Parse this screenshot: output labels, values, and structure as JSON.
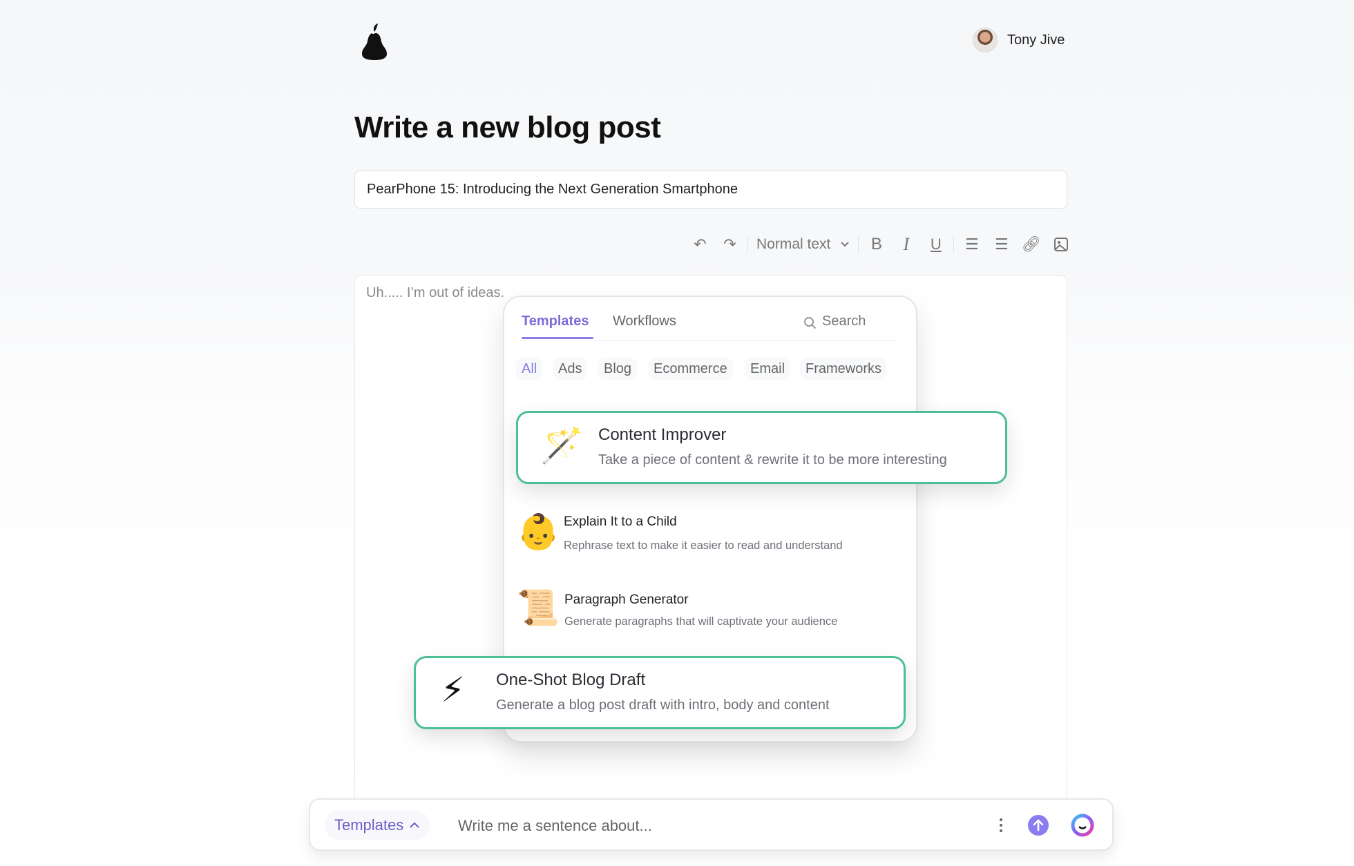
{
  "header": {
    "logo": "pear-logo",
    "user_name": "Tony Jive"
  },
  "page_title": "Write a new blog post",
  "title_input": {
    "value": "PearPhone 15: Introducing the Next Generation Smartphone"
  },
  "toolbar": {
    "text_style": "Normal text",
    "icons": [
      "undo-icon",
      "redo-icon",
      "chevron-down-icon",
      "bold-icon",
      "italic-icon",
      "underline-icon",
      "bullet-list-icon",
      "numbered-list-icon",
      "link-icon",
      "image-icon"
    ]
  },
  "editor": {
    "content": "Uh..... I’m out of ideas."
  },
  "popup": {
    "tabs": [
      "Templates",
      "Workflows"
    ],
    "active_tab": "Templates",
    "search_placeholder": "Search",
    "categories": [
      "All",
      "Ads",
      "Blog",
      "Ecommerce",
      "Email",
      "Frameworks"
    ],
    "active_category": "All",
    "items": [
      {
        "icon": "🪄",
        "title": "Content Improver",
        "description": "Take a piece of content & rewrite it to be more interesting"
      },
      {
        "icon": "👶",
        "title": "Explain It to a Child",
        "description": "Rephrase text to make it easier to read and understand"
      },
      {
        "icon": "📜",
        "title": "Paragraph Generator",
        "description": "Generate paragraphs that will captivate your audience"
      },
      {
        "icon": "⚡",
        "title": "One-Shot Blog Draft",
        "description": "Generate a blog post draft with intro, body and content"
      }
    ]
  },
  "bottom_bar": {
    "templates_label": "Templates",
    "input_placeholder": "Write me a sentence about..."
  },
  "colors": {
    "accent": "#7b6cd9",
    "highlight_border": "#4cbf93",
    "send_button": "#8b7cf0"
  }
}
